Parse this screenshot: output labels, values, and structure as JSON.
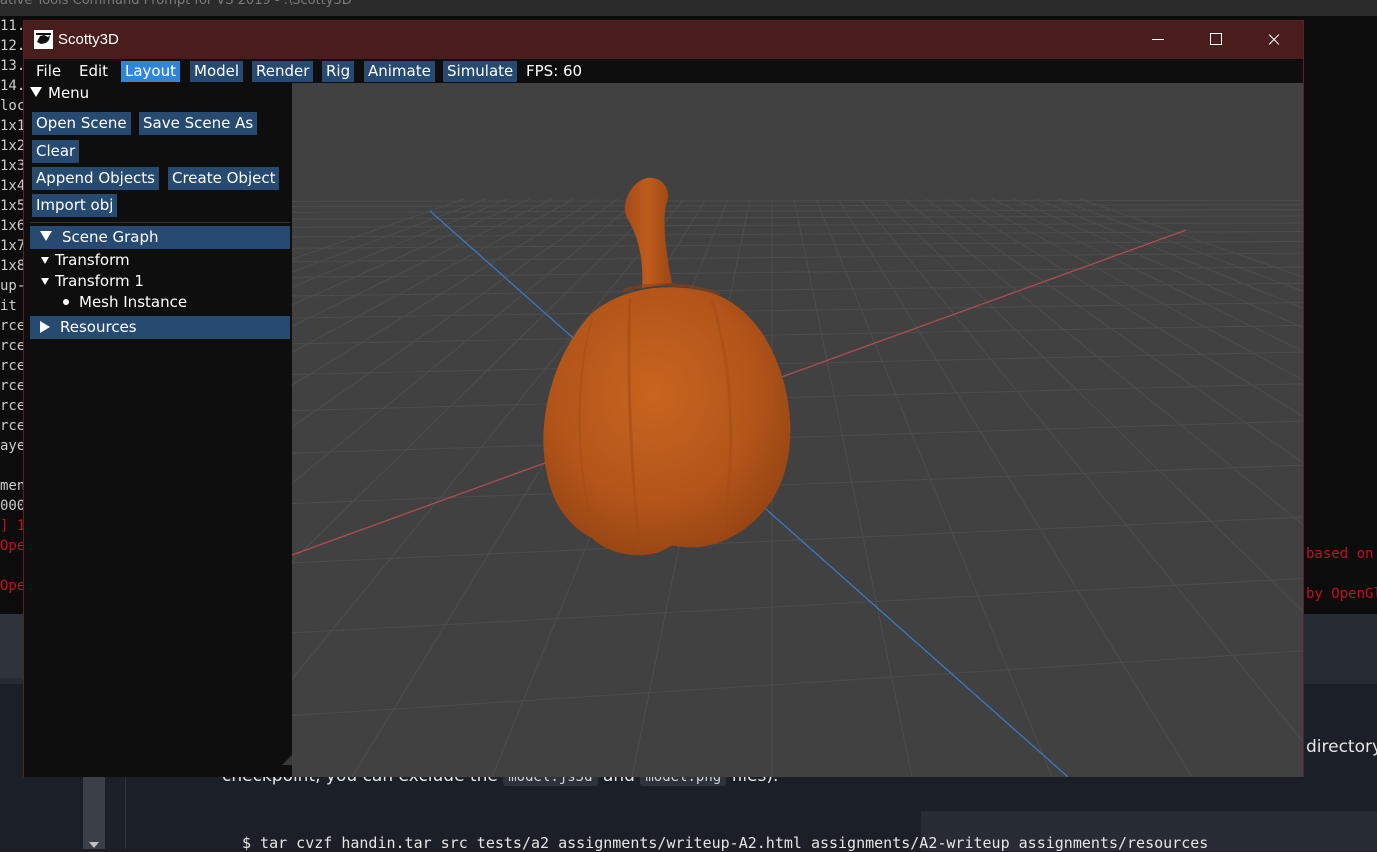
{
  "background": {
    "terminal_title": "ative Tools Command Prompt for VS 2019 - .\\Scotty3D",
    "terminal_left_fragments": [
      "11.",
      "12.",
      "13.",
      "14.",
      "loc",
      "1x1",
      "1x2",
      "1x3",
      "1x4",
      "1x5",
      "1x6",
      "1x7",
      "1x8",
      "up-",
      "it",
      "rce",
      "rce",
      "rce",
      "rce",
      "rce",
      "rce",
      "aye",
      "",
      "men",
      "000",
      "] 1",
      "Ope",
      "",
      "Ope"
    ],
    "terminal_right_red": [
      "based on",
      "by OpenGl"
    ],
    "doc_directory": "directory",
    "doc_line_start": "checkpoint, you can exclude the",
    "doc_code1": "model.js3d",
    "doc_and": "and",
    "doc_code2": "model.png",
    "doc_line_end": "files).",
    "doc_command": "$ tar cvzf handin.tar src tests/a2 assignments/writeup-A2.html assignments/A2-writeup assignments/resources"
  },
  "window": {
    "title": "Scotty3D",
    "logo_icon": "scotty3d-logo-icon"
  },
  "menubar": {
    "file": "File",
    "edit": "Edit",
    "tabs": [
      "Layout",
      "Model",
      "Render",
      "Rig",
      "Animate",
      "Simulate"
    ],
    "active_tab": "Layout",
    "fps": "FPS: 60"
  },
  "sidebar": {
    "menu_header": "Menu",
    "buttons": {
      "open_scene": "Open Scene",
      "save_scene_as": "Save Scene As",
      "clear": "Clear",
      "append_objects": "Append Objects",
      "create_object": "Create Object",
      "import_obj": "Import obj"
    },
    "scene_graph": {
      "header": "Scene Graph",
      "items": [
        "Transform",
        "Transform 1",
        "Mesh Instance"
      ]
    },
    "resources": "Resources"
  },
  "viewport": {
    "object": "pumpkin-mesh",
    "colors": {
      "background": "#414141",
      "grid": "#4b4b4b",
      "x_axis": "#b14a58",
      "z_axis": "#3b78c0",
      "mesh": "#b9581b"
    }
  }
}
